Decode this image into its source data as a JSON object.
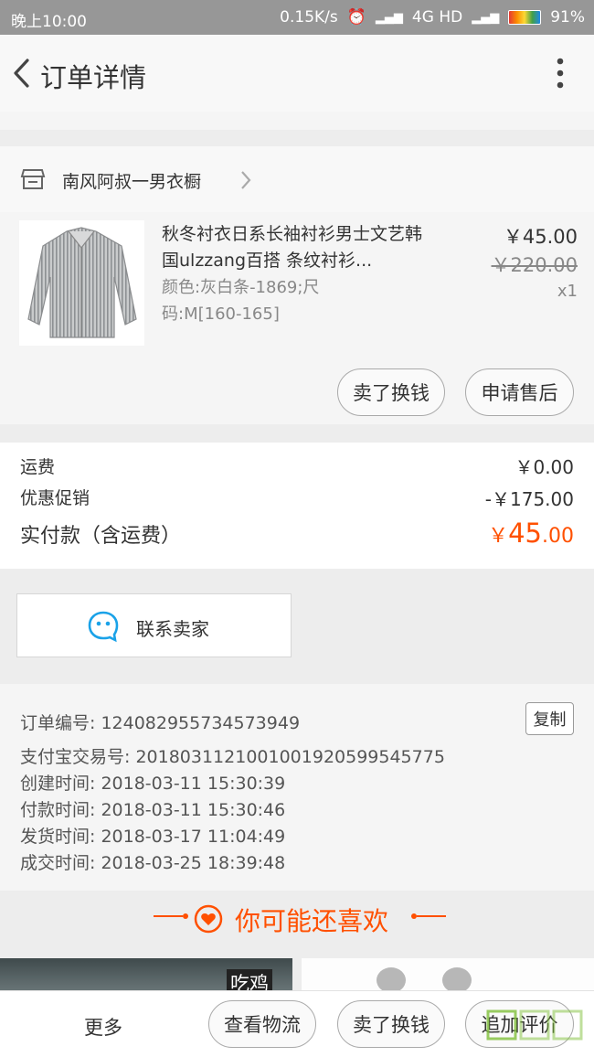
{
  "status_bar": {
    "time": "晚上10:00",
    "speed": "0.15K/s",
    "network": "4G HD",
    "battery": "91%"
  },
  "header": {
    "title": "订单详情"
  },
  "shop": {
    "name": "南风阿叔一男衣橱"
  },
  "product": {
    "title": "秋冬衬衣日系长袖衬衫男士文艺韩国ulzzang百搭 条纹衬衫...",
    "spec": "颜色:灰白条-1869;尺码:M[160-165]",
    "price": "￥45.00",
    "original_price": "￥220.00",
    "quantity": "x1",
    "btn_sell": "卖了换钱",
    "btn_after_sale": "申请售后"
  },
  "totals": {
    "shipping_label": "运费",
    "shipping_value": "￥0.00",
    "discount_label": "优惠促销",
    "discount_value": "-￥175.00",
    "paid_label": "实付款（含运费）",
    "paid_currency": "￥",
    "paid_int": "45",
    "paid_dec": ".00"
  },
  "contact": {
    "label": "联系卖家"
  },
  "order_info": {
    "copy": "复制",
    "rows": [
      "订单编号: 124082955734573949",
      "支付宝交易号: 2018031121001001920599545775",
      "创建时间: 2018-03-11 15:30:39",
      "付款时间: 2018-03-11 15:30:46",
      "发货时间: 2018-03-17 11:04:49",
      "成交时间: 2018-03-25 18:39:48"
    ]
  },
  "recommend": {
    "title": "你可能还喜欢",
    "tile_text": "吃鸡"
  },
  "bottom_bar": {
    "more": "更多",
    "logistics": "查看物流",
    "sell": "卖了换钱",
    "review": "追加评价"
  },
  "colors": {
    "accent": "#ff5000",
    "background": "#ededed"
  }
}
